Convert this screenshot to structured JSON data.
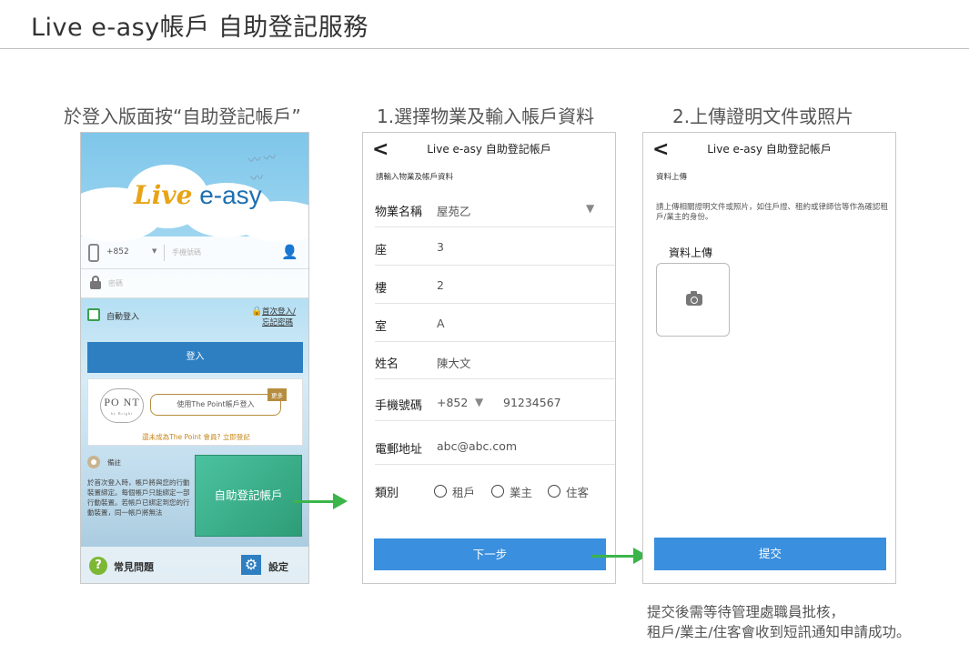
{
  "page_title": "Live e-asy帳戶 自助登記服務",
  "captions": [
    "於登入版面按“自助登記帳戶”",
    "1.選擇物業及輸入帳戶資料",
    "2.上傳證明文件或照片"
  ],
  "login_screen": {
    "logo_live": "Live",
    "logo_easy": " e-asy",
    "country_code": "+852",
    "mobile_placeholder": "手機號碼",
    "password_placeholder": "密碼",
    "auto_login_label": "自動登入",
    "first_login_link_1": "首次登入/",
    "first_login_link_2": "忘記密碼",
    "login_button": "登入",
    "point_logo": "PO NT",
    "point_logo_sub": "by Bright",
    "point_button": "使用The Point帳戶登入",
    "more_badge": "更多",
    "point_register_link": "還未成為The Point 會員? 立即登記",
    "notes_title": "備註",
    "notes_text": "於首次登入時，帳戶將與您的行動裝置綁定。每個帳戶只能綁定一部行動裝置。若帳戶已綁定到您的行動裝置，同一帳戶將無法",
    "self_register_button": "自助登記帳戶",
    "faq_label": "常見問題",
    "settings_label": "設定"
  },
  "register_screen": {
    "header_title": "Live e-asy 自助登記帳戶",
    "subtitle": "請輸入物業及帳戶資料",
    "fields": {
      "property_label": "物業名稱",
      "property_value": "屋苑乙",
      "block_label": "座",
      "block_value": "3",
      "floor_label": "樓",
      "floor_value": "2",
      "unit_label": "室",
      "unit_value": "A",
      "name_label": "姓名",
      "name_value": "陳大文",
      "phone_label": "手機號碼",
      "phone_code": "+852",
      "phone_value": "91234567",
      "email_label": "電郵地址",
      "email_value": "abc@abc.com",
      "type_label": "類別"
    },
    "type_options": [
      "租戶",
      "業主",
      "住客"
    ],
    "next_button": "下一步"
  },
  "upload_screen": {
    "header_title": "Live e-asy 自助登記帳戶",
    "subtitle": "資料上傳",
    "description": "請上傳相關證明文件或照片，如住戶證、租約或律師信等作為確認租戶/業主的身份。",
    "upload_label": "資料上傳",
    "submit_button": "提交"
  },
  "footnote_line1": "提交後需等待管理處職員批核，",
  "footnote_line2": "租戶/業主/住客會收到短訊通知申請成功。",
  "colors": {
    "accent_blue": "#3a8fde",
    "login_blue": "#2e7fc2",
    "green_button": "#3aa981",
    "arrow_green": "#3bb54a",
    "gold": "#b68d3f"
  }
}
